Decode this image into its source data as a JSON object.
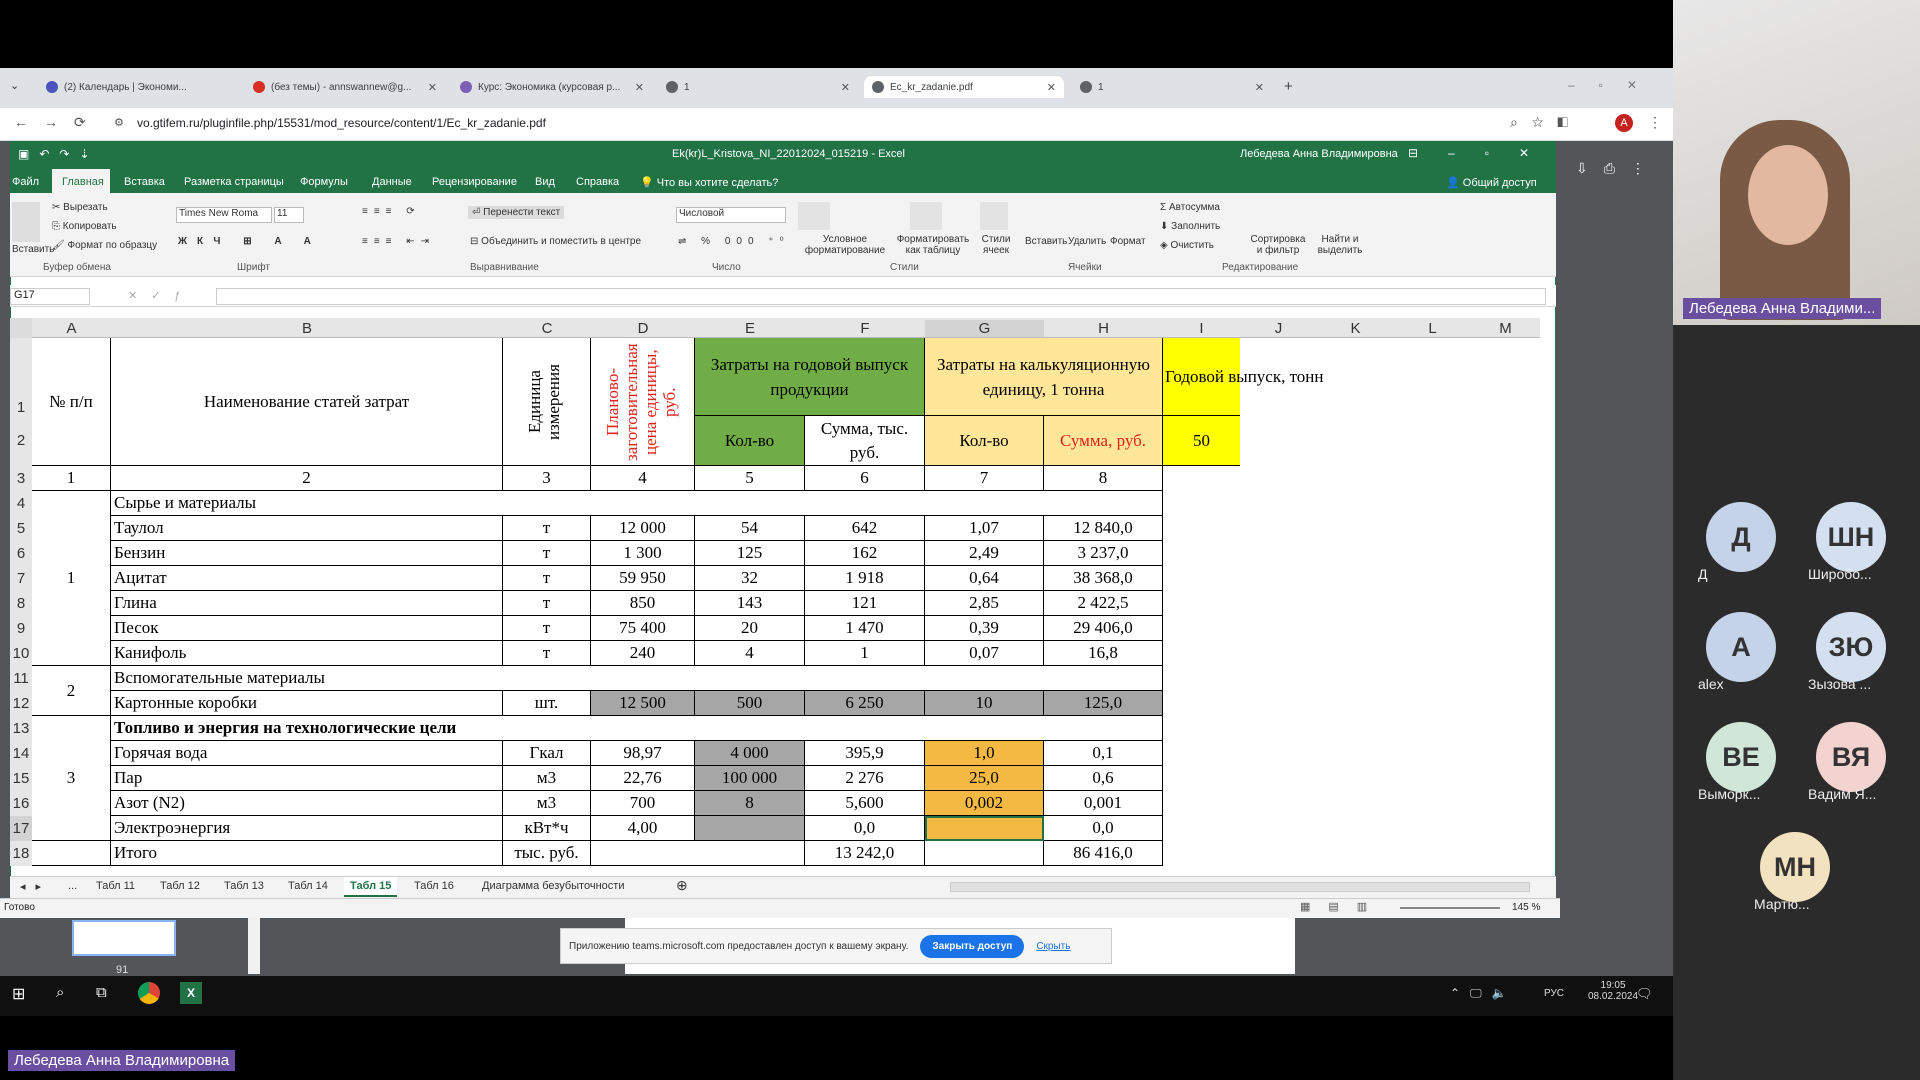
{
  "browser": {
    "tabs": [
      {
        "title": "(2) Календарь | Экономи..."
      },
      {
        "title": "(без темы) - annswannew@g..."
      },
      {
        "title": "Курс: Экономика (курсовая р..."
      },
      {
        "title": "1"
      },
      {
        "title": "Ec_kr_zadanie.pdf"
      },
      {
        "title": "1"
      }
    ],
    "url": "vo.gtifem.ru/pluginfile.php/15531/mod_resource/content/1/Ec_kr_zadanie.pdf"
  },
  "excel": {
    "window_title": "Ek(kr)L_Kristova_NI_22012024_015219  -  Excel",
    "user": "Лебедева Анна Владимировна",
    "menu": [
      "Файл",
      "Главная",
      "Вставка",
      "Разметка страницы",
      "Формулы",
      "Данные",
      "Рецензирование",
      "Вид",
      "Справка"
    ],
    "tell_me": "Что вы хотите сделать?",
    "share": "Общий доступ",
    "ribbon": {
      "cut": "Вырезать",
      "copy": "Копировать",
      "format_painter": "Формат по образцу",
      "paste": "Вставить",
      "font_name": "Times New Roma",
      "font_size": "11",
      "wrap": "Перенести текст",
      "merge": "Объединить и поместить в центре",
      "number_format": "Числовой",
      "cond_format": "Условное форматирование",
      "format_table": "Форматировать как таблицу",
      "cell_styles": "Стили ячеек",
      "insert": "Вставить",
      "delete": "Удалить",
      "format": "Формат",
      "autosum": "Автосумма",
      "fill": "Заполнить",
      "clear": "Очистить",
      "sort": "Сортировка и фильтр",
      "find": "Найти и выделить",
      "groups": [
        "Буфер обмена",
        "Шрифт",
        "Выравнивание",
        "Число",
        "Стили",
        "Ячейки",
        "Редактирование"
      ]
    },
    "name_box": "G17",
    "columns": [
      "A",
      "B",
      "C",
      "D",
      "E",
      "F",
      "G",
      "H",
      "I",
      "J",
      "K",
      "L",
      "M"
    ],
    "rows": [
      "1",
      "2",
      "3",
      "4",
      "5",
      "6",
      "7",
      "8",
      "9",
      "10",
      "11",
      "12",
      "13",
      "14",
      "15",
      "16",
      "17",
      "18"
    ],
    "header": {
      "num": "№ п/п",
      "name": "Наименование статей затрат",
      "unit": "Единица измерения",
      "price": "Планово-заготовительная цена единицы, руб.",
      "annual": "Затраты на годовой выпуск продукции",
      "unit_cost": "Затраты на  калькуляционную единицу, 1 тонна",
      "annual_output": "Годовой выпуск, тонн",
      "annual_output_value": "50",
      "qty": "Кол-во",
      "sum_k": "Сумма, тыс. руб.",
      "qty2": "Кол-во",
      "sum_r": "Сумма, руб.",
      "colnums": [
        "1",
        "2",
        "3",
        "4",
        "5",
        "6",
        "7",
        "8"
      ]
    },
    "sections": {
      "s1": "Сырье и материалы",
      "s1n": "1",
      "s2": "Вспомогательные материалы",
      "s2n": "2",
      "s3": "Топливо и энергия на технологические цели",
      "s3n": "3"
    },
    "data": [
      {
        "name": "Таулол",
        "unit": "т",
        "price": "12 000",
        "qty": "54",
        "sum": "642",
        "q1": "1,07",
        "s1": "12 840,0"
      },
      {
        "name": "Бензин",
        "unit": "т",
        "price": "1 300",
        "qty": "125",
        "sum": "162",
        "q1": "2,49",
        "s1": "3 237,0"
      },
      {
        "name": "Ацитат",
        "unit": "т",
        "price": "59 950",
        "qty": "32",
        "sum": "1 918",
        "q1": "0,64",
        "s1": "38 368,0"
      },
      {
        "name": "Глина",
        "unit": "т",
        "price": "850",
        "qty": "143",
        "sum": "121",
        "q1": "2,85",
        "s1": "2 422,5"
      },
      {
        "name": "Песок",
        "unit": "т",
        "price": "75 400",
        "qty": "20",
        "sum": "1 470",
        "q1": "0,39",
        "s1": "29 406,0"
      },
      {
        "name": "Канифоль",
        "unit": "т",
        "price": "240",
        "qty": "4",
        "sum": "1",
        "q1": "0,07",
        "s1": "16,8"
      },
      {
        "name": "Картонные коробки",
        "unit": "шт.",
        "price": "12 500",
        "qty": "500",
        "sum": "6 250",
        "q1": "10",
        "s1": "125,0"
      },
      {
        "name": "Горячая вода",
        "unit": "Гкал",
        "price": "98,97",
        "qty": "4 000",
        "sum": "395,9",
        "q1": "1,0",
        "s1": "0,1"
      },
      {
        "name": "Пар",
        "unit": "м3",
        "price": "22,76",
        "qty": "100 000",
        "sum": "2 276",
        "q1": "25,0",
        "s1": "0,6"
      },
      {
        "name": "Азот (N2)",
        "unit": "м3",
        "price": "700",
        "qty": "8",
        "sum": "5,600",
        "q1": "0,002",
        "s1": "0,001"
      },
      {
        "name": "Электроэнергия",
        "unit": "кВт*ч",
        "price": "4,00",
        "qty": "",
        "sum": "0,0",
        "q1": "",
        "s1": "0,0"
      }
    ],
    "total": {
      "name": "Итого",
      "unit": "тыс. руб.",
      "sum": "13 242,0",
      "s1": "86 416,0"
    },
    "sheet_tabs": [
      "...",
      "Табл 11",
      "Табл 12",
      "Табл 13",
      "Табл 14",
      "Табл 15",
      "Табл 16",
      "Диаграмма безубыточности"
    ],
    "status": "Готово",
    "zoom": "145 %"
  },
  "share_banner": {
    "text": "Приложению teams.microsoft.com предоставлен доступ к вашему экрану.",
    "stop": "Закрыть доступ",
    "hide": "Скрыть"
  },
  "page_thumb": "91",
  "taskbar": {
    "lang": "РУС",
    "time": "19:05",
    "date": "08.02.2024"
  },
  "participants": {
    "presenter": "Лебедева Анна Владими...",
    "list": [
      {
        "initials": "Д",
        "name": "Д",
        "color": "#c5d3e8"
      },
      {
        "initials": "ШН",
        "name": "Широбо...",
        "color": "#d4e0ef"
      },
      {
        "initials": "A",
        "name": "alex",
        "color": "#c5d3e8"
      },
      {
        "initials": "ЗЮ",
        "name": "Зызова ...",
        "color": "#d4e0ef"
      },
      {
        "initials": "ВЕ",
        "name": "Выморк...",
        "color": "#cfe6d8"
      },
      {
        "initials": "ВЯ",
        "name": "Вадим Я...",
        "color": "#f2d3cf"
      },
      {
        "initials": "МН",
        "name": "Мартю...",
        "color": "#f3e2c0"
      }
    ]
  },
  "bottom_name": "Лебедева Анна Владимировна"
}
